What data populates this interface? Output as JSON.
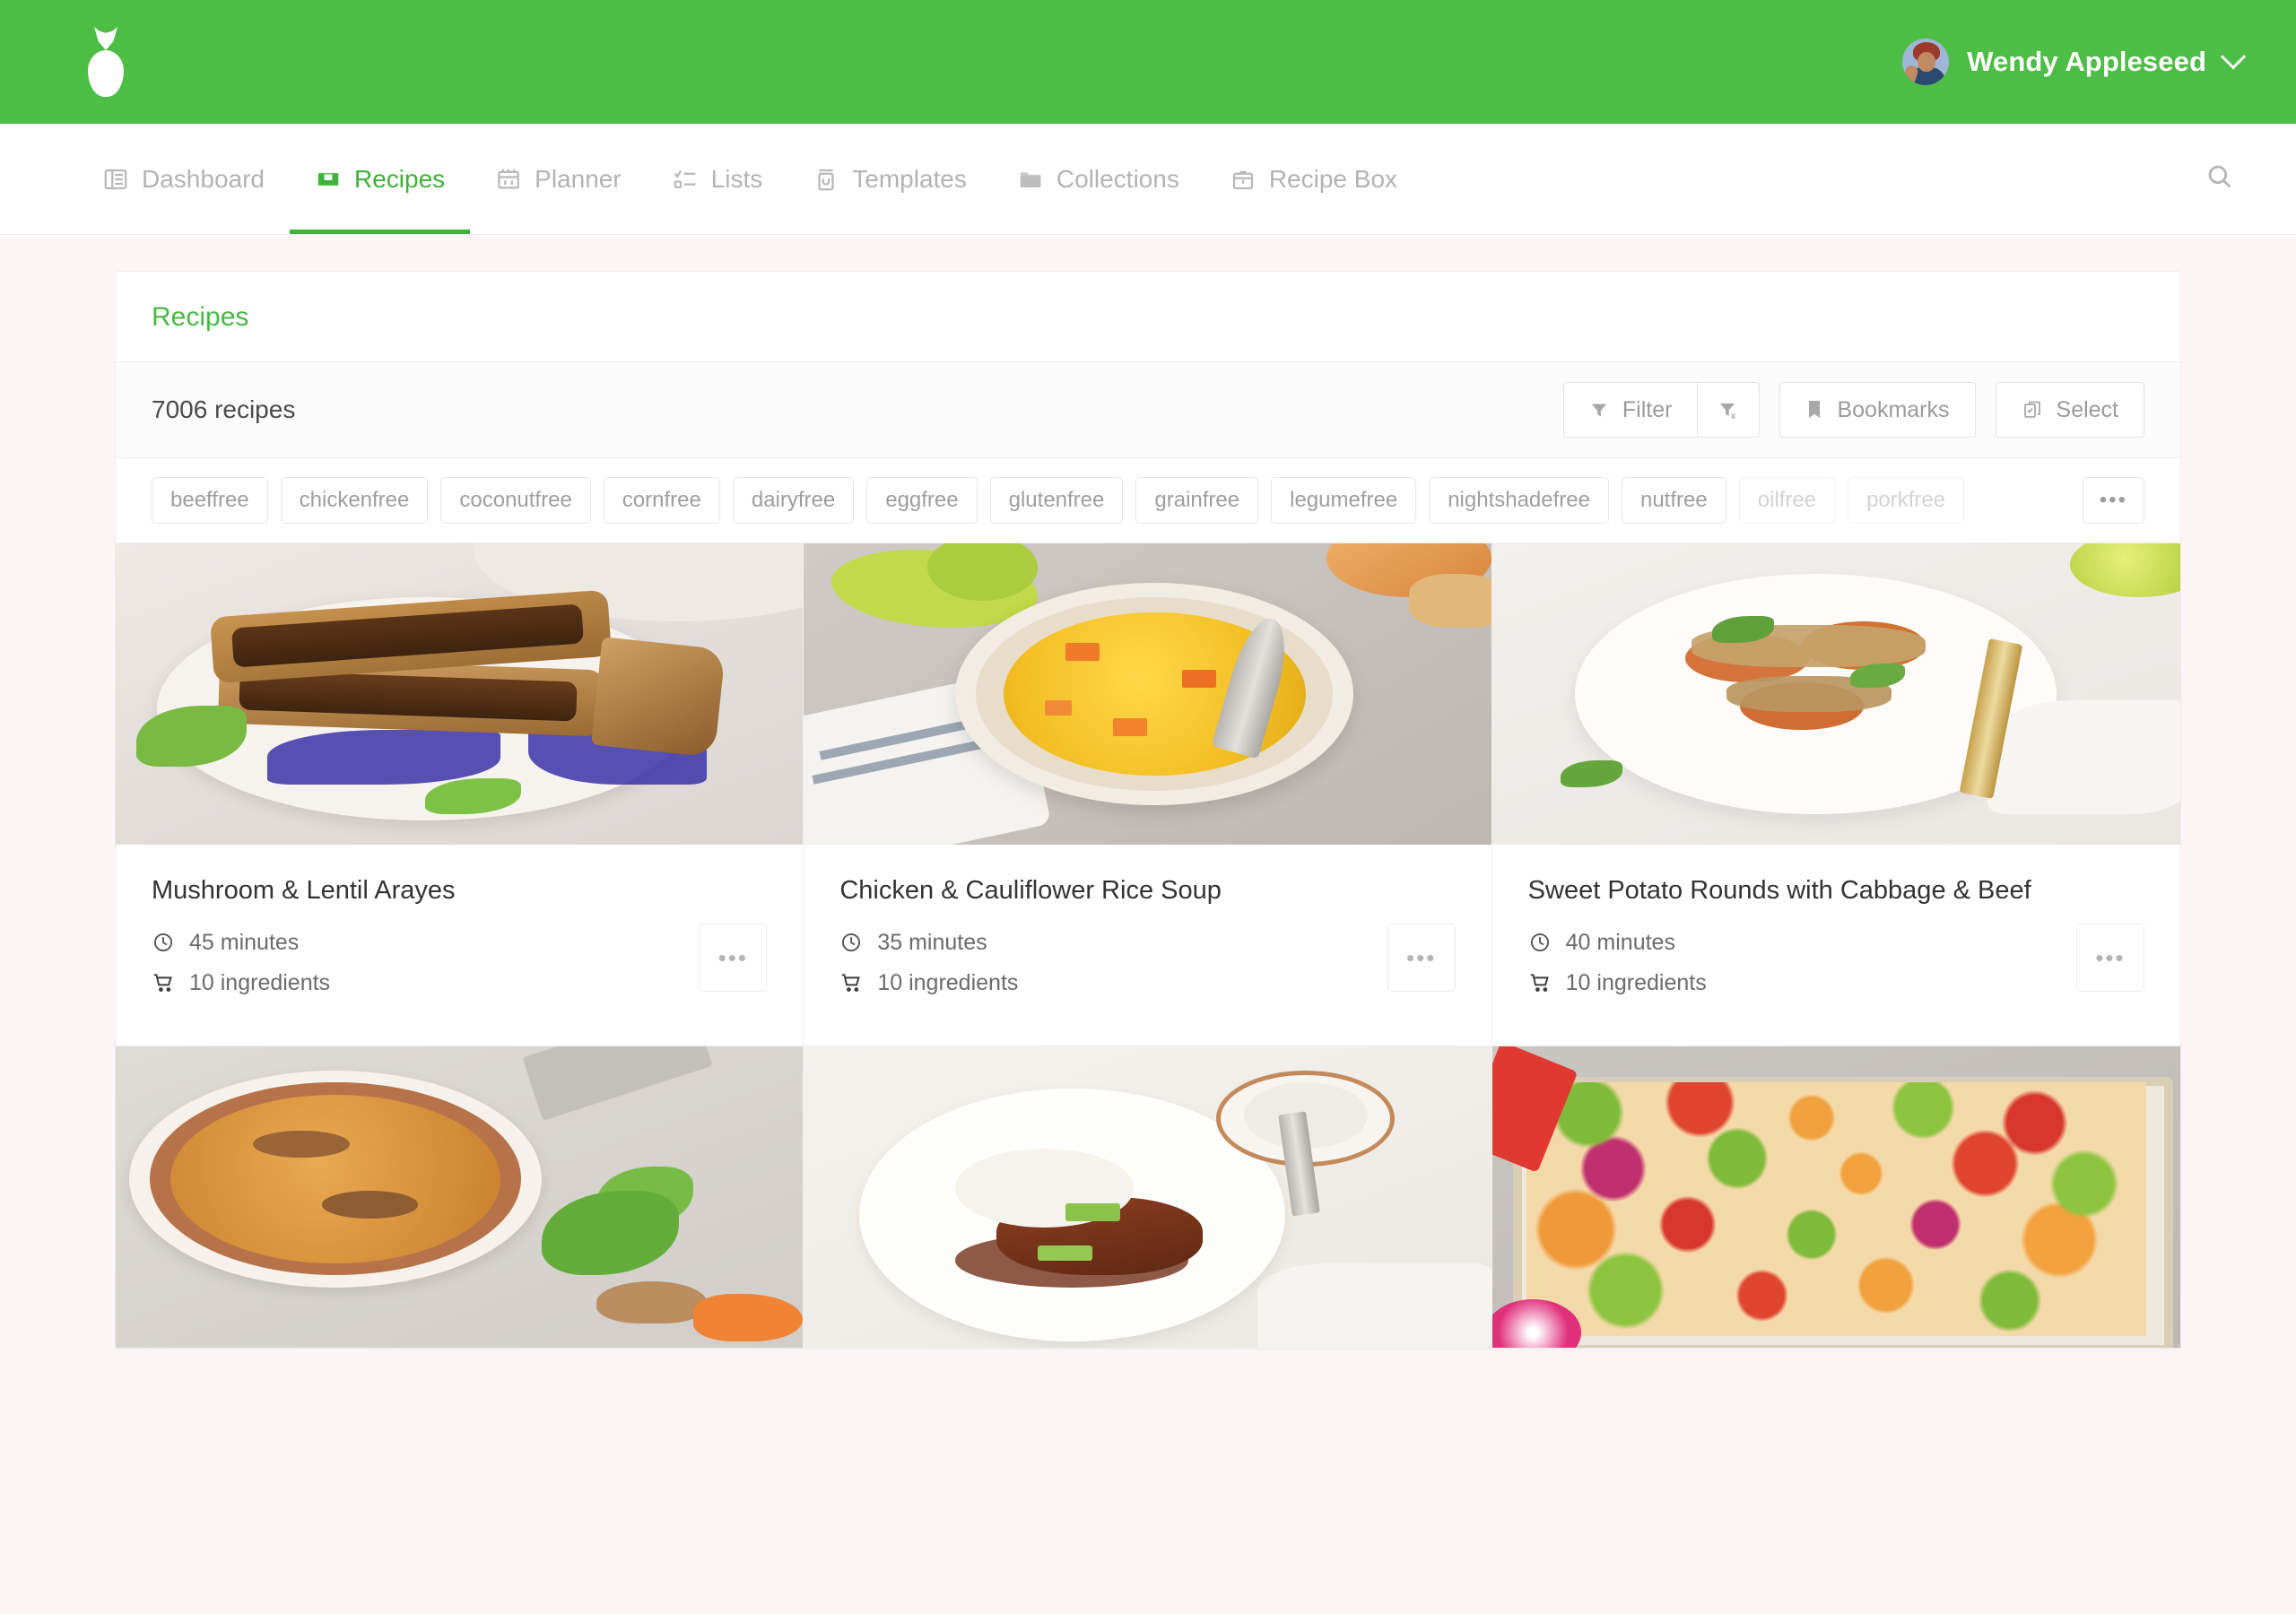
{
  "header": {
    "logo_name": "pineapple-logo",
    "user_name": "Wendy Appleseed",
    "brand_color": "#4cbd45"
  },
  "nav": {
    "items": [
      {
        "label": "Dashboard",
        "icon": "dashboard-icon",
        "active": false
      },
      {
        "label": "Recipes",
        "icon": "recipes-icon",
        "active": true
      },
      {
        "label": "Planner",
        "icon": "calendar-icon",
        "active": false
      },
      {
        "label": "Lists",
        "icon": "checklist-icon",
        "active": false
      },
      {
        "label": "Templates",
        "icon": "templates-icon",
        "active": false
      },
      {
        "label": "Collections",
        "icon": "folder-icon",
        "active": false
      },
      {
        "label": "Recipe Box",
        "icon": "recipe-box-icon",
        "active": false
      }
    ],
    "search_icon": "search-icon",
    "active_color": "#3fb23a",
    "inactive_color": "#b3b3b3"
  },
  "panel": {
    "title": "Recipes",
    "count_text": "7006 recipes",
    "buttons": {
      "filter": "Filter",
      "clear_filter_icon": "filter-clear-icon",
      "bookmarks": "Bookmarks",
      "select": "Select"
    }
  },
  "tags": {
    "items": [
      {
        "label": "beeffree",
        "faded": false
      },
      {
        "label": "chickenfree",
        "faded": false
      },
      {
        "label": "coconutfree",
        "faded": false
      },
      {
        "label": "cornfree",
        "faded": false
      },
      {
        "label": "dairyfree",
        "faded": false
      },
      {
        "label": "eggfree",
        "faded": false
      },
      {
        "label": "glutenfree",
        "faded": false
      },
      {
        "label": "grainfree",
        "faded": false
      },
      {
        "label": "legumefree",
        "faded": false
      },
      {
        "label": "nightshadefree",
        "faded": false
      },
      {
        "label": "nutfree",
        "faded": false
      },
      {
        "label": "oilfree",
        "faded": true
      },
      {
        "label": "porkfree",
        "faded": true
      }
    ],
    "more_label": "•••"
  },
  "recipes": [
    {
      "title": "Mushroom & Lentil Arayes",
      "time": "45 minutes",
      "ingredients": "10 ingredients",
      "more_label": "•••",
      "photo": "stuffed-pita-on-blue-patterned-plate"
    },
    {
      "title": "Chicken & Cauliflower Rice Soup",
      "time": "35 minutes",
      "ingredients": "10 ingredients",
      "more_label": "•••",
      "photo": "yellow-soup-bowl-with-carrots"
    },
    {
      "title": "Sweet Potato Rounds with Cabbage & Beef",
      "time": "40 minutes",
      "ingredients": "10 ingredients",
      "more_label": "•••",
      "photo": "sweet-potato-rounds-with-lime"
    },
    {
      "title": "",
      "time": "",
      "ingredients": "",
      "more_label": "",
      "photo": "mushroom-noodle-soup-bowl"
    },
    {
      "title": "",
      "time": "",
      "ingredients": "",
      "more_label": "",
      "photo": "beef-and-rice-plate"
    },
    {
      "title": "",
      "time": "",
      "ingredients": "",
      "more_label": "",
      "photo": "sheet-pan-shrimp-and-vegetables"
    }
  ],
  "colors": {
    "page_background": "#fbf6f5",
    "panel_background": "#ffffff",
    "accent_green": "#48b944",
    "text_primary": "#333333",
    "text_muted": "#9e9e9e"
  }
}
